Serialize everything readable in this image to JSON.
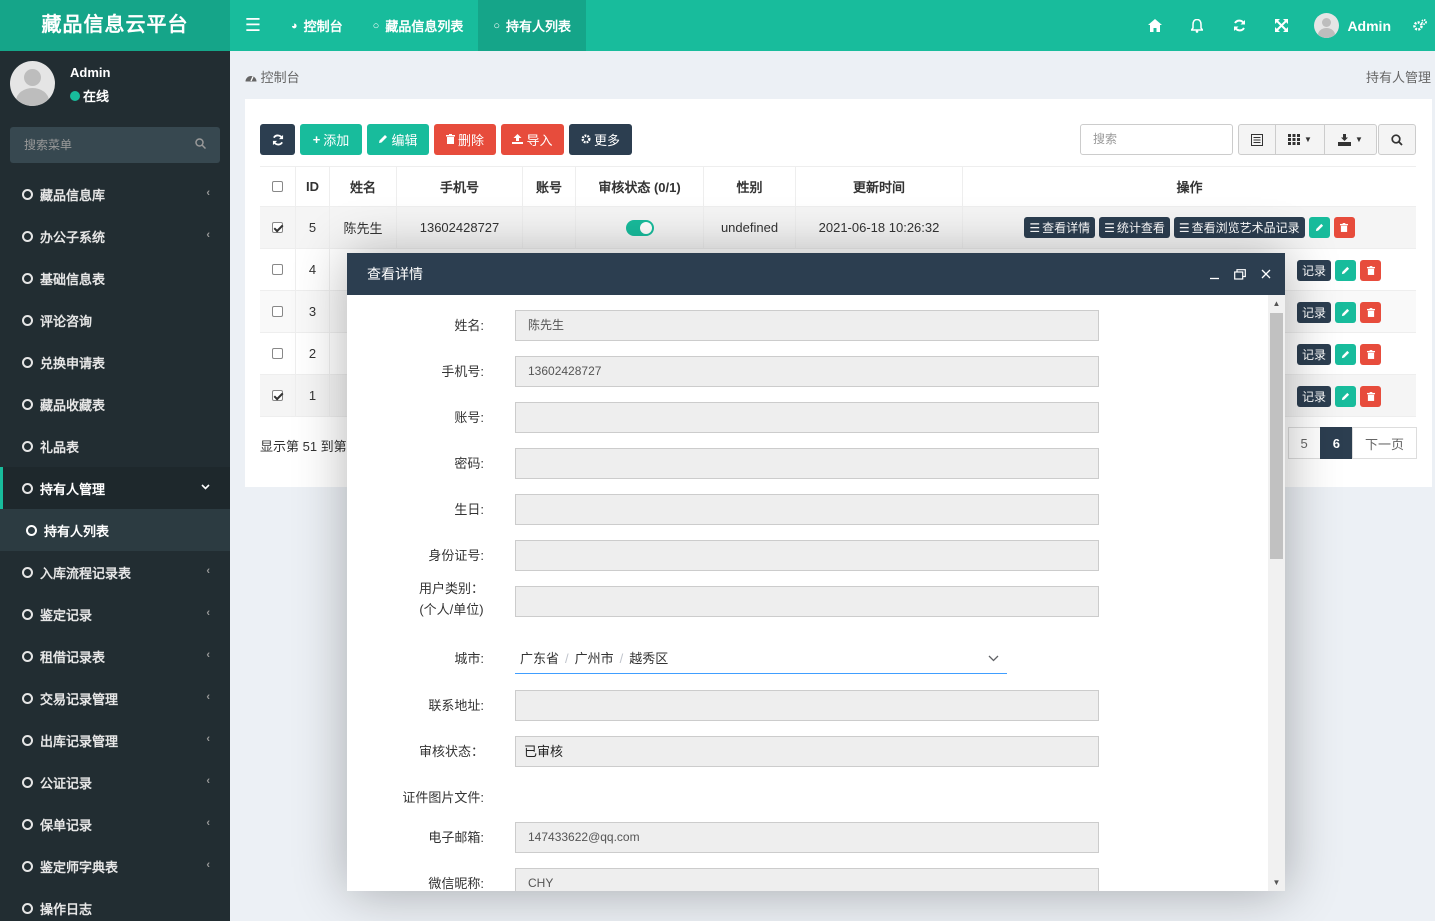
{
  "header": {
    "logo": "藏品信息云平台",
    "toggle_icon": "☰",
    "tabs": [
      {
        "icon": "dashboard-icon",
        "glyph": "◕",
        "label": "控制台"
      },
      {
        "icon": "circle-icon",
        "glyph": "○",
        "label": "藏品信息列表"
      },
      {
        "icon": "circle-icon",
        "glyph": "○",
        "label": "持有人列表",
        "active": true
      }
    ],
    "right_icons": [
      "home-icon",
      "bell-icon",
      "refresh-icon",
      "fullscreen-icon"
    ],
    "user_name": "Admin",
    "settings_icon": "gears-icon"
  },
  "sidebar": {
    "user_name": "Admin",
    "status": "在线",
    "search_placeholder": "搜索菜单",
    "items": [
      {
        "label": "藏品信息库",
        "arrow": "‹"
      },
      {
        "label": "办公子系统",
        "arrow": "‹"
      },
      {
        "label": "基础信息表",
        "arrow": ""
      },
      {
        "label": "评论咨询",
        "arrow": ""
      },
      {
        "label": "兑换申请表",
        "arrow": ""
      },
      {
        "label": "藏品收藏表",
        "arrow": ""
      },
      {
        "label": "礼品表",
        "arrow": ""
      },
      {
        "label": "持有人管理",
        "arrow": "⌄",
        "open": true
      },
      {
        "label": "持有人列表",
        "arrow": "",
        "sub": true
      },
      {
        "label": "入库流程记录表",
        "arrow": "‹"
      },
      {
        "label": "鉴定记录",
        "arrow": "‹"
      },
      {
        "label": "租借记录表",
        "arrow": "‹"
      },
      {
        "label": "交易记录管理",
        "arrow": "‹"
      },
      {
        "label": "出库记录管理",
        "arrow": "‹"
      },
      {
        "label": "公证记录",
        "arrow": "‹"
      },
      {
        "label": "保单记录",
        "arrow": "‹"
      },
      {
        "label": "鉴定师字典表",
        "arrow": "‹"
      },
      {
        "label": "操作日志",
        "arrow": ""
      }
    ]
  },
  "breadcrumb": {
    "home": "控制台",
    "right": "持有人管理"
  },
  "toolbar": {
    "refresh_icon": "⟳",
    "add": "添加",
    "edit": "编辑",
    "delete": "删除",
    "import": "导入",
    "more": "更多",
    "search_placeholder": "搜索"
  },
  "table": {
    "columns": [
      "",
      "ID",
      "姓名",
      "手机号",
      "账号",
      "审核状态 (0/1)",
      "性别",
      "更新时间",
      "操作"
    ],
    "first_row": {
      "id": "5",
      "name": "陈先生",
      "phone": "13602428727",
      "account": "",
      "gender": "undefined",
      "updated": "2021-06-18 10:26:32",
      "checked": true
    },
    "other_ids": [
      "4",
      "3",
      "2",
      "1"
    ],
    "other_checked": [
      false,
      false,
      false,
      true
    ],
    "ops": {
      "detail": "查看详情",
      "stats": "统计查看",
      "browse": "查看浏览艺术品记录",
      "browse_peek": "记录"
    }
  },
  "footer": {
    "info": "显示第 51 到第",
    "pages": [
      "5",
      "6"
    ],
    "active_page": "6",
    "next": "下一页"
  },
  "modal": {
    "title": "查看详情",
    "fields": [
      {
        "label": "姓名:",
        "value": "陈先生"
      },
      {
        "label": "手机号:",
        "value": "13602428727"
      },
      {
        "label": "账号:",
        "value": ""
      },
      {
        "label": "密码:",
        "value": ""
      },
      {
        "label": "生日:",
        "value": ""
      },
      {
        "label": "身份证号:",
        "value": ""
      },
      {
        "label": "用户类别：\n(个人/单位)",
        "value": ""
      },
      {
        "label": "城市:",
        "city": [
          "广东省",
          "广州市",
          "越秀区"
        ]
      },
      {
        "label": "联系地址:",
        "value": ""
      },
      {
        "label": "审核状态：",
        "value": "已审核"
      },
      {
        "label": "证件图片文件:"
      },
      {
        "label": "电子邮箱:",
        "value": "147433622@qq.com"
      },
      {
        "label": "微信昵称:",
        "value": "CHY"
      }
    ]
  }
}
